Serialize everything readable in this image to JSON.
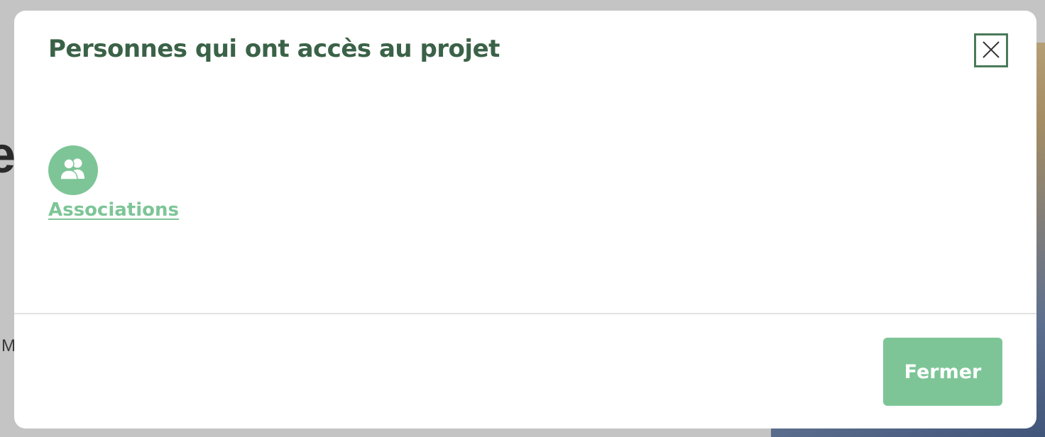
{
  "background": {
    "heading_fragment": "ei",
    "text_fragment": "M"
  },
  "modal": {
    "title": "Personnes qui ont accès au projet",
    "close_icon": "close-icon",
    "groups": [
      {
        "label": "Associations",
        "icon": "users-icon"
      }
    ],
    "footer": {
      "close_label": "Fermer"
    }
  },
  "colors": {
    "title": "#3a6247",
    "accent": "#7dc597",
    "close_border": "#4a7a5a"
  }
}
